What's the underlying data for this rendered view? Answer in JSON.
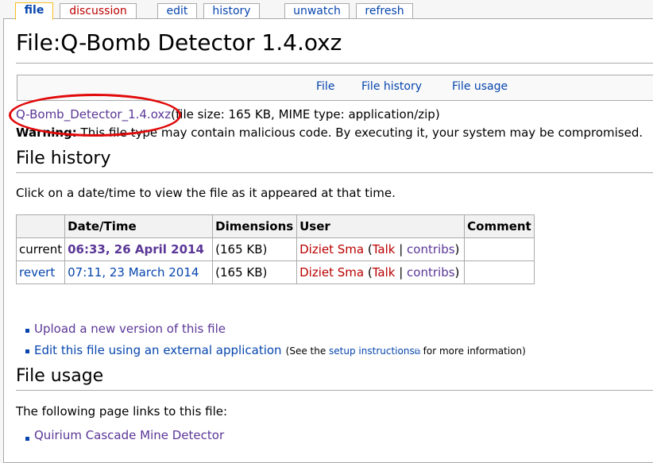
{
  "tabs": [
    {
      "label": "file",
      "selected": true
    },
    {
      "label": "discussion",
      "new": true
    },
    {
      "label": "edit"
    },
    {
      "label": "history"
    },
    {
      "label": "unwatch"
    },
    {
      "label": "refresh"
    }
  ],
  "page_title": "File:Q-Bomb Detector 1.4.oxz",
  "file_toc": [
    "File",
    "File history",
    "File usage"
  ],
  "file_info": {
    "link": "Q-Bomb_Detector_1.4.oxz",
    "details": "(file size: 165 KB, MIME type: application/zip)",
    "warning_label": "Warning:",
    "warning_text": " This file type may contain malicious code. By executing it, your system may be compromised."
  },
  "history": {
    "heading": "File history",
    "intro": "Click on a date/time to view the file as it appeared at that time.",
    "columns": [
      "",
      "Date/Time",
      "Dimensions",
      "User",
      "Comment"
    ],
    "rows": [
      {
        "action": "current",
        "datetime": "06:33, 26 April 2014",
        "dimensions": "(165 KB)",
        "user": "Diziet Sma",
        "talk": "Talk",
        "contribs": "contribs",
        "comment": ""
      },
      {
        "action": "revert",
        "datetime": "07:11, 23 March 2014",
        "dimensions": "(165 KB)",
        "user": "Diziet Sma",
        "talk": "Talk",
        "contribs": "contribs",
        "comment": ""
      }
    ],
    "upload_link": "Upload a new version of this file",
    "edit_link": "Edit this file using an external application",
    "edit_note_pre": "(See the ",
    "edit_note_link": "setup instructions",
    "edit_note_post": " for more information)"
  },
  "usage": {
    "heading": "File usage",
    "intro": "The following page links to this file:",
    "pages": [
      "Quirium Cascade Mine Detector"
    ]
  },
  "colors": {
    "annotation_ellipse": "#e10a0a",
    "link": "#0645ad",
    "visited_link": "#5a3696",
    "new_link": "#ba0000",
    "selected_tab_border": "#fabd23"
  }
}
